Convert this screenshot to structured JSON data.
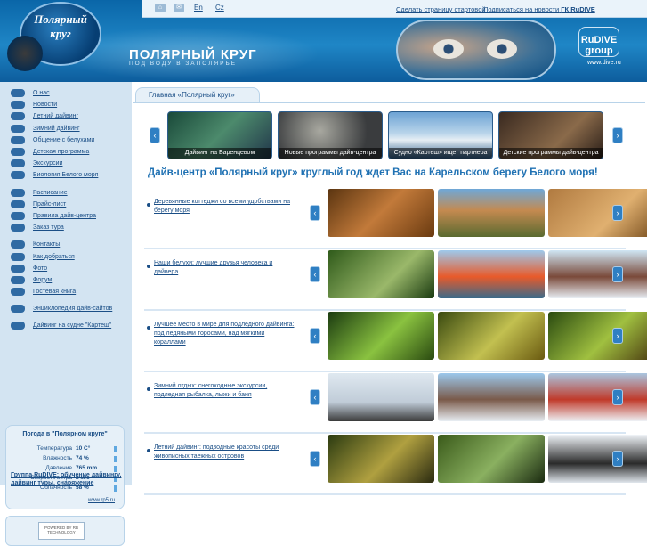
{
  "header": {
    "logo_line1": "Полярный",
    "logo_line2": "круг",
    "site_title": "ПОЛЯРНЫЙ КРУГ",
    "site_subtitle": "ПОД ВОДУ В ЗАПОЛЯРЬЕ",
    "lang_en": "En",
    "lang_cz": "Cz",
    "homepage_link": "Сделать страницу стартовой",
    "subscribe_prefix": "Подписаться на новости",
    "subscribe_brand": "ГК RuDIVE",
    "partner_logo": "RuDIVE group",
    "partner_url": "www.dive.ru"
  },
  "sidebar": {
    "menu_group1": [
      "О нас",
      "Новости",
      "Летний дайвинг",
      "Зимний дайвинг",
      "Общение с белухами",
      "Детская программа",
      "Экскурсии",
      "Биология Белого моря"
    ],
    "menu_group2": [
      "Расписание",
      "Прайс-лист",
      "Правила дайв-центра",
      "Заказ тура"
    ],
    "menu_group3": [
      "Контакты",
      "Как добраться",
      "Фото",
      "Форум",
      "Гостевая книга"
    ],
    "menu_group4": [
      "Энциклопедия дайв-сайтов"
    ],
    "menu_group5": [
      "Дайвинг на судне \"Картеш\""
    ],
    "weather": {
      "title": "Погода в \"Полярном круге\"",
      "rows": [
        {
          "label": "Температура",
          "value": "10 C°"
        },
        {
          "label": "Влажность",
          "value": "74 %"
        },
        {
          "label": "Давление",
          "value": "765 mm"
        },
        {
          "label": "Скорость ветра",
          "value": "2 м/с"
        },
        {
          "label": "Облачность",
          "value": "58 %"
        }
      ],
      "source": "www.rp5.ru"
    },
    "badge_text": "POWERED BY RB TECHNOLOGY",
    "footer_link": "Группа RuDIVE: обучение дайвингу, дайвинг туры, снаряжение"
  },
  "main": {
    "tab_label": "Главная «Полярный круг»",
    "carousel": [
      "Дайвинг на Баренцевом",
      "Новые программы дайв-центра",
      "Судно «Картеш» ищет партнера",
      "Детские программы дайв-центра"
    ],
    "headline": "Дайв-центр «Полярный круг» круглый год ждет Вас на Карельском берегу Белого моря!",
    "rows": [
      {
        "text": "Деревянные коттеджи со всеми удобствами на берегу моря"
      },
      {
        "text": "Наши белухи: лучшие друзья человека и дайвера"
      },
      {
        "text": "Лучшее место в мире для подледного дайвинга: под ледяными торосами, над мягкими кораллами"
      },
      {
        "text": "Зимний отдых: снегоходные экскурсии, подледная рыбалка, лыжи и баня"
      },
      {
        "text": "Летний дайвинг: подводные красоты среди живописных таежных островов"
      }
    ]
  },
  "colors": {
    "accent": "#1f71b3",
    "link": "#1a4e86",
    "sidebar_bg": "#d3e4f2",
    "header_bg": "#0a66a8"
  }
}
